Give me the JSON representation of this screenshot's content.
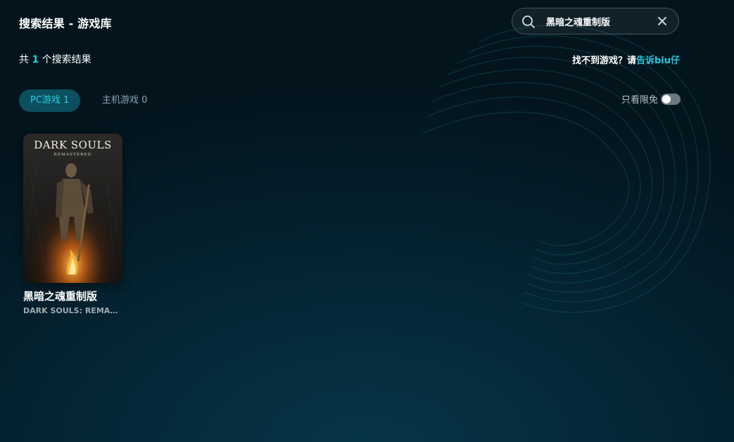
{
  "header": {
    "title": "搜索结果 - 游戏库"
  },
  "search": {
    "value": "黑暗之魂重制版",
    "icon": "search-icon",
    "clear_icon": "close-icon"
  },
  "results": {
    "prefix": "共",
    "count": "1",
    "suffix": "个搜索结果"
  },
  "missing": {
    "text": "找不到游戏？请",
    "link": "告诉biu仔"
  },
  "tabs": [
    {
      "label": "PC游戏 1",
      "active": true
    },
    {
      "label": "主机游戏 0",
      "active": false
    }
  ],
  "filter": {
    "label": "只看限免",
    "enabled": false
  },
  "games": [
    {
      "title": "黑暗之魂重制版",
      "subtitle": "DARK SOULS: REMAST...",
      "cover_title": "DARK SOULS",
      "cover_subtitle": "REMASTERED"
    }
  ],
  "colors": {
    "accent": "#20c9e0",
    "active_tab_bg": "#0c4f5e",
    "background": "#041f2c"
  }
}
